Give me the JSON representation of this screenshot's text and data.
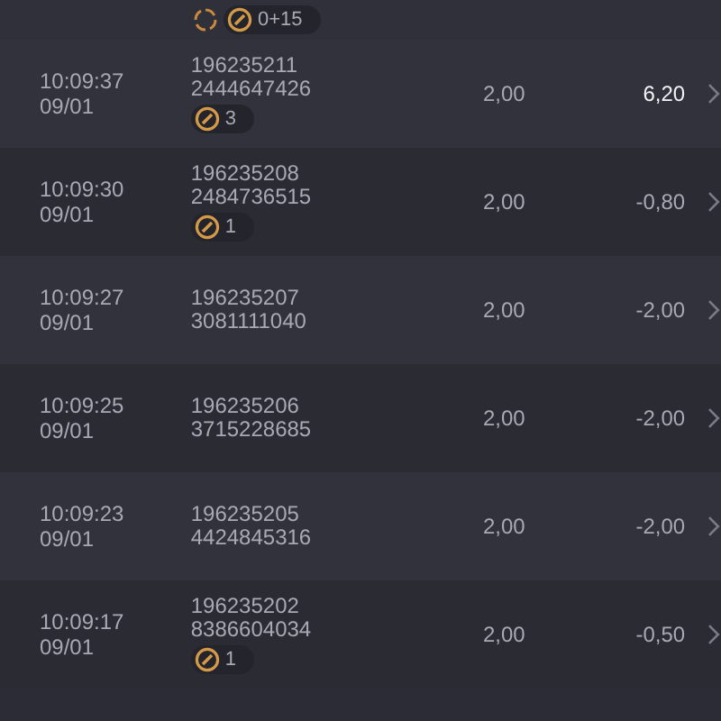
{
  "partial_row": {
    "tags": [
      {
        "kind": "spinner"
      },
      {
        "kind": "ball",
        "count": "0+15"
      }
    ]
  },
  "rows": [
    {
      "time": "10:09:37",
      "date": "09/01",
      "ticket": "196235211",
      "code": "2444647426",
      "tags": [
        {
          "kind": "ball",
          "count": "3"
        }
      ],
      "stake": "2,00",
      "result": "6,20",
      "won": true
    },
    {
      "time": "10:09:30",
      "date": "09/01",
      "ticket": "196235208",
      "code": "2484736515",
      "tags": [
        {
          "kind": "ball",
          "count": "1"
        }
      ],
      "stake": "2,00",
      "result": "-0,80",
      "won": false
    },
    {
      "time": "10:09:27",
      "date": "09/01",
      "ticket": "196235207",
      "code": "3081111040",
      "tags": [],
      "stake": "2,00",
      "result": "-2,00",
      "won": false
    },
    {
      "time": "10:09:25",
      "date": "09/01",
      "ticket": "196235206",
      "code": "3715228685",
      "tags": [],
      "stake": "2,00",
      "result": "-2,00",
      "won": false
    },
    {
      "time": "10:09:23",
      "date": "09/01",
      "ticket": "196235205",
      "code": "4424845316",
      "tags": [],
      "stake": "2,00",
      "result": "-2,00",
      "won": false
    },
    {
      "time": "10:09:17",
      "date": "09/01",
      "ticket": "196235202",
      "code": "8386604034",
      "tags": [
        {
          "kind": "ball",
          "count": "1"
        }
      ],
      "stake": "2,00",
      "result": "-0,50",
      "won": false
    }
  ]
}
